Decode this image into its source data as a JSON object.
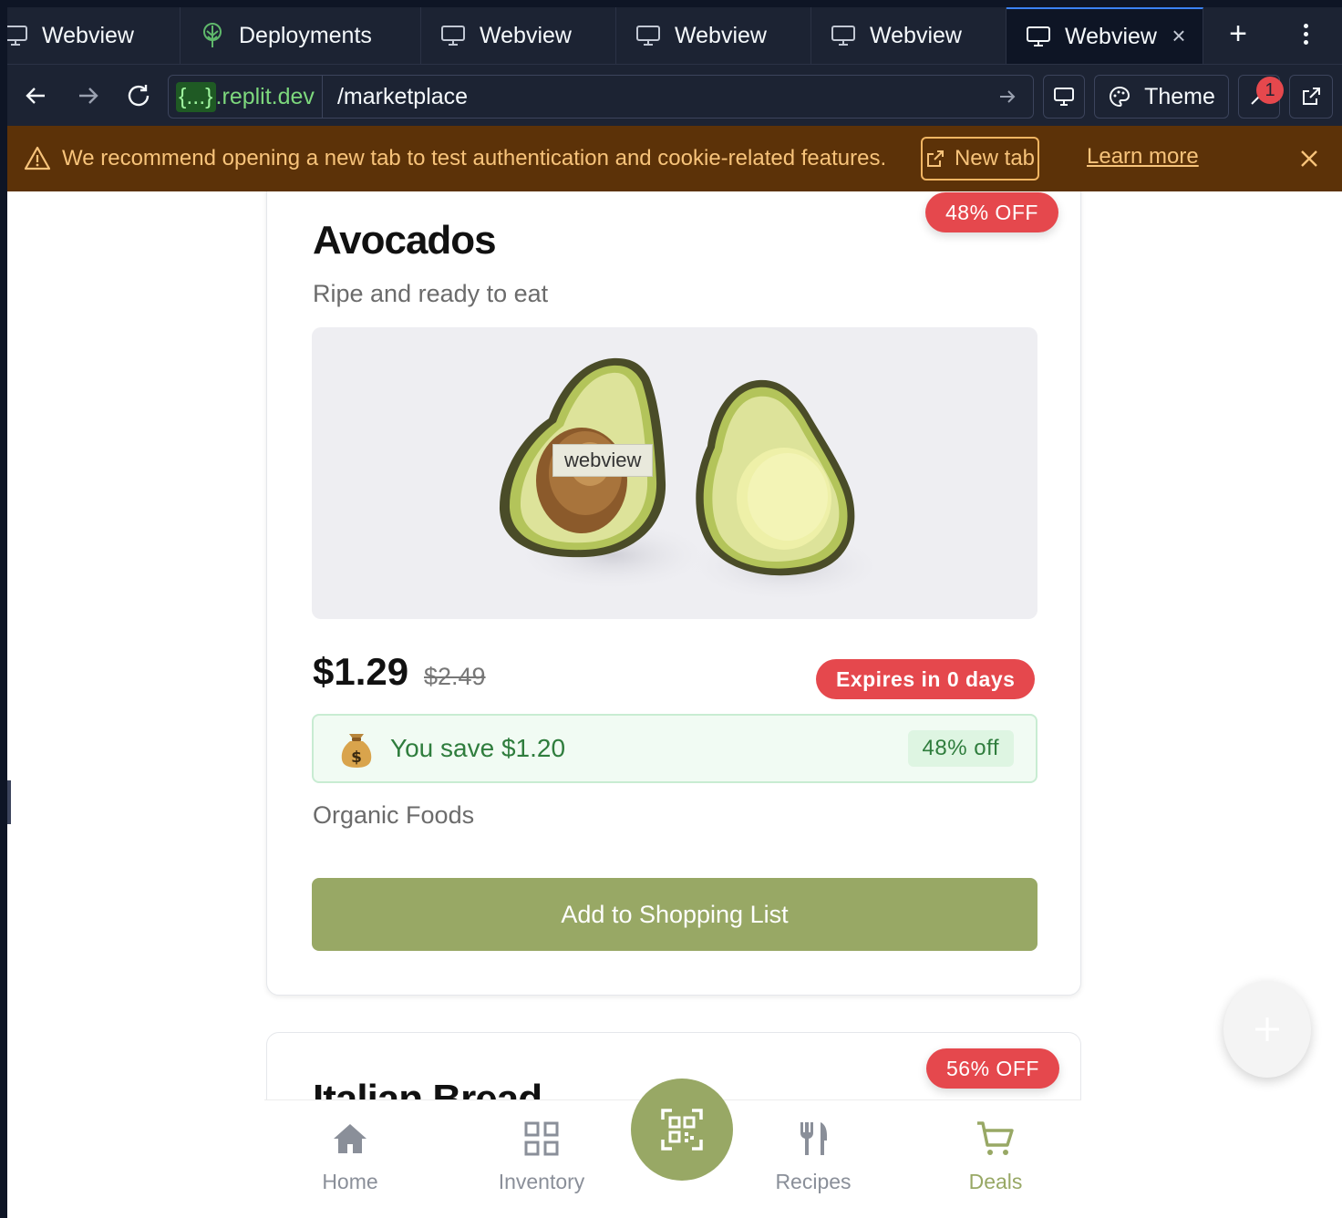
{
  "tabs": [
    {
      "label": "Webview",
      "icon": "monitor-icon",
      "active": false
    },
    {
      "label": "Deployments",
      "icon": "deployments-icon",
      "active": false
    },
    {
      "label": "Webview",
      "icon": "monitor-icon",
      "active": false
    },
    {
      "label": "Webview",
      "icon": "monitor-icon",
      "active": false
    },
    {
      "label": "Webview",
      "icon": "monitor-icon",
      "active": false
    },
    {
      "label": "Webview",
      "icon": "monitor-icon",
      "active": true
    }
  ],
  "address": {
    "domain_prefix": "{...}",
    "domain_suffix": ".replit.dev",
    "path": "/marketplace"
  },
  "toolbar": {
    "theme_label": "Theme",
    "devtools_badge": "1"
  },
  "banner": {
    "message": "We recommend opening a new tab to test authentication and cookie-related features.",
    "new_tab_label": "New tab",
    "learn_more_label": "Learn more"
  },
  "product": {
    "discount_badge": "48% OFF",
    "name": "Avocados",
    "description": "Ripe and ready to eat",
    "image_overlay_label": "webview",
    "price": "$1.29",
    "original_price": "$2.49",
    "expiry": "Expires in 0 days",
    "savings_text": "You save $1.20",
    "savings_percent": "48% off",
    "store": "Organic Foods",
    "add_button": "Add to Shopping List"
  },
  "next_product": {
    "discount_badge": "56% OFF",
    "name": "Italian Bread"
  },
  "bottom_nav": {
    "items": [
      {
        "label": "Home",
        "icon": "home-icon",
        "active": false
      },
      {
        "label": "Inventory",
        "icon": "grid-icon",
        "active": false
      },
      {
        "label": "Recipes",
        "icon": "utensils-icon",
        "active": false
      },
      {
        "label": "Deals",
        "icon": "cart-icon",
        "active": true
      }
    ],
    "scan_icon": "qr-scan-icon"
  },
  "colors": {
    "accent": "#98a865",
    "danger": "#e5484d",
    "savings_green": "#2f7d3d",
    "banner_bg": "#5c3208",
    "banner_text": "#f7c37a"
  }
}
